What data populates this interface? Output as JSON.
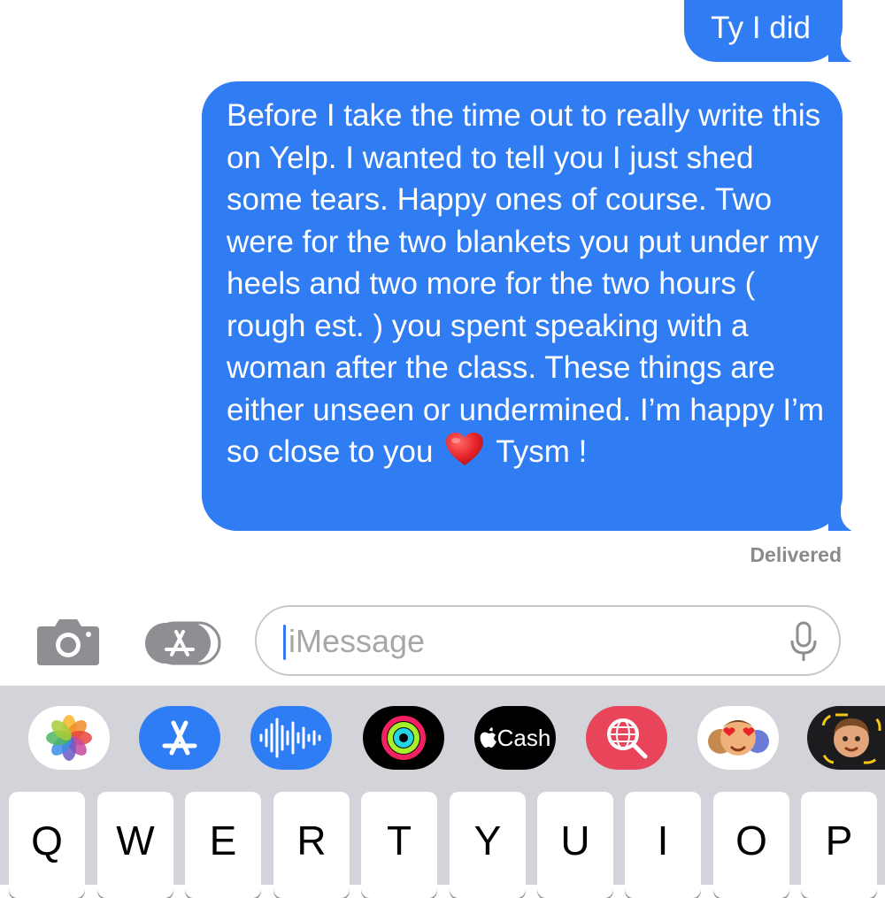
{
  "messages": [
    {
      "sender": "me",
      "text": "Ty I did"
    },
    {
      "sender": "me",
      "text_before_emoji": "Before I take the time out to really write this on Yelp. I wanted to tell you I just shed some tears. Happy ones of course. Two were for the two blankets you put under my heels and two more for the two hours ( rough est. ) you spent speaking with a woman after the class. These things are either unseen or undermined. I’m happy I’m so close to you",
      "emoji": "red-heart",
      "text_after_emoji": "Tysm !"
    }
  ],
  "status": "Delivered",
  "input": {
    "placeholder": "iMessage"
  },
  "app_drawer": [
    {
      "name": "Photos"
    },
    {
      "name": "App Store"
    },
    {
      "name": "Audio"
    },
    {
      "name": "Activity"
    },
    {
      "name": "Apple Cash",
      "label": "Cash"
    },
    {
      "name": "Images search"
    },
    {
      "name": "Memoji stickers"
    },
    {
      "name": "Memoji"
    }
  ],
  "keyboard": {
    "row1": [
      "Q",
      "W",
      "E",
      "R",
      "T",
      "Y",
      "U",
      "I",
      "O",
      "P"
    ]
  },
  "colors": {
    "bubble": "#2f7cf3",
    "drawer": "#d2d4d9",
    "status_text": "#8a8a8e"
  }
}
